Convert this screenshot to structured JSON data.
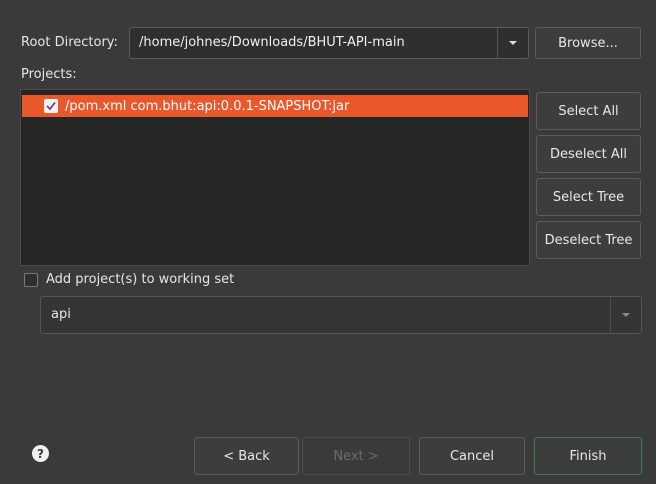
{
  "root": {
    "label": "Root Directory:",
    "value": "/home/johnes/Downloads/BHUT-API-main",
    "browse_label": "Browse..."
  },
  "projects": {
    "label": "Projects:",
    "items": [
      {
        "text": "/pom.xml  com.bhut:api:0.0.1-SNAPSHOT:jar",
        "checked": true,
        "selected": true
      }
    ]
  },
  "side_buttons": {
    "select_all": "Select All",
    "deselect_all": "Deselect All",
    "select_tree": "Select Tree",
    "deselect_tree": "Deselect Tree"
  },
  "working_set": {
    "checkbox_label": "Add project(s) to working set",
    "checked": false,
    "value": "api"
  },
  "footer": {
    "help_icon": "question-circle-icon",
    "back": "< Back",
    "next": "Next >",
    "cancel": "Cancel",
    "finish": "Finish"
  },
  "colors": {
    "background": "#3a3a3a",
    "selection": "#e9572b",
    "checkmark": "#7a3c8c"
  }
}
